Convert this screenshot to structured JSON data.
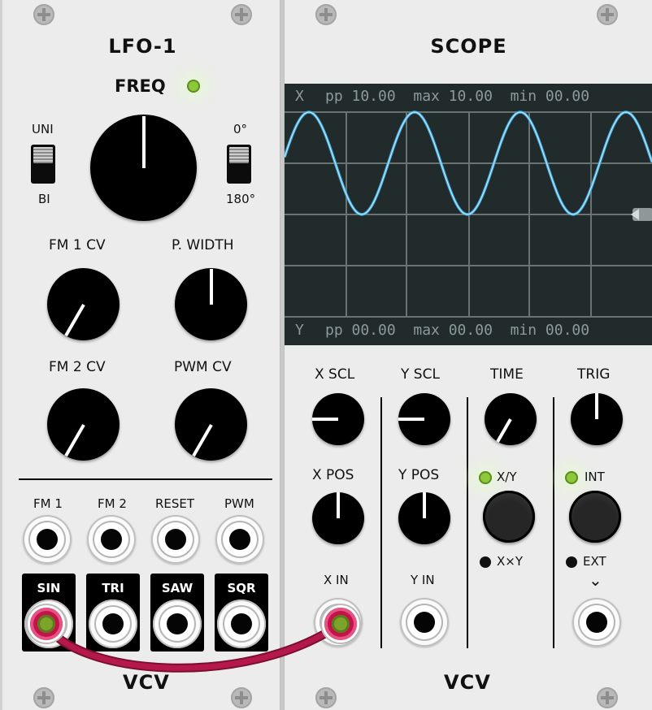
{
  "lfo": {
    "title": "LFO-1",
    "freq_label": "FREQ",
    "uni_label": "UNI",
    "bi_label": "BI",
    "deg0_label": "0°",
    "deg180_label": "180°",
    "fm1cv_label": "FM 1 CV",
    "pwidth_label": "P. WIDTH",
    "fm2cv_label": "FM 2 CV",
    "pwmcv_label": "PWM CV",
    "inputs": [
      "FM 1",
      "FM 2",
      "RESET",
      "PWM"
    ],
    "outputs": [
      "SIN",
      "TRI",
      "SAW",
      "SQR"
    ],
    "logo": "VCV"
  },
  "scope": {
    "title": "SCOPE",
    "screen": {
      "x_channel": "X",
      "x_stats": "pp 10.00  max 10.00  min 00.00",
      "y_channel": "Y",
      "y_stats": "pp 00.00  max 00.00  min 00.00",
      "trace_color": "#3fa9dc"
    },
    "xscl_label": "X SCL",
    "yscl_label": "Y SCL",
    "time_label": "TIME",
    "trig_label": "TRIG",
    "xpos_label": "X POS",
    "ypos_label": "Y POS",
    "xy_label": "X/Y",
    "xxy_label": "X×Y",
    "int_label": "INT",
    "ext_label": "EXT",
    "xin_label": "X IN",
    "yin_label": "Y IN",
    "chevron": "⌄",
    "logo": "VCV"
  },
  "colors": {
    "led_on": "#8bc93a",
    "cable": "#b5184a",
    "plug_tip": "#7ca32a"
  }
}
